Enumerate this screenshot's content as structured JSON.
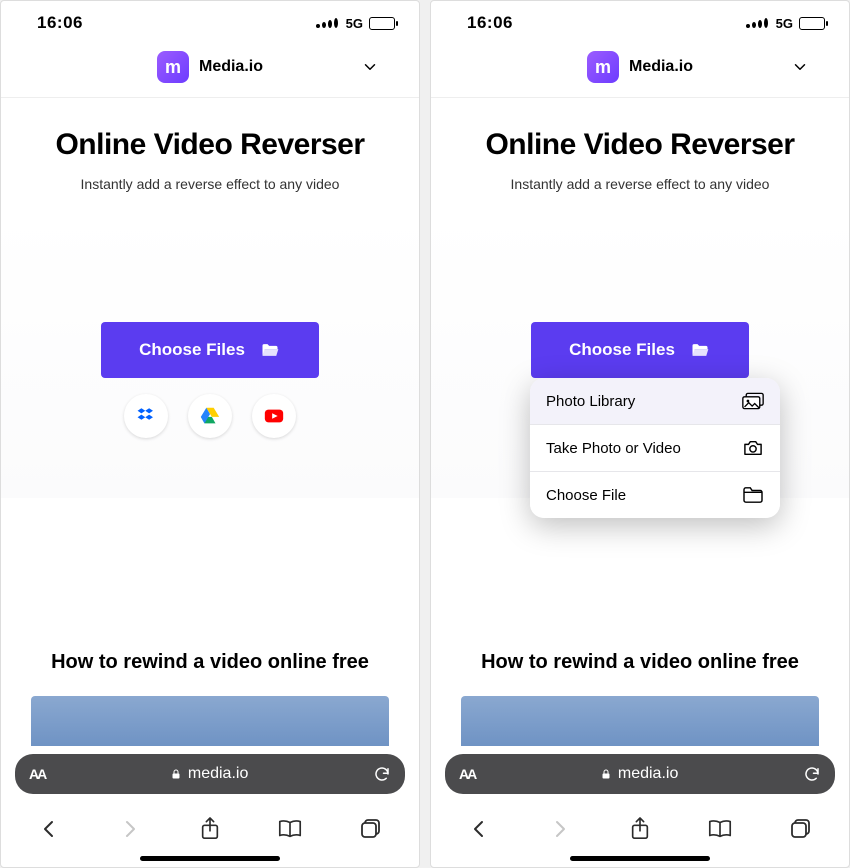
{
  "status": {
    "time": "16:06",
    "network": "5G"
  },
  "header": {
    "brand": "Media.io",
    "logo_glyph": "m"
  },
  "hero": {
    "title": "Online Video Reverser",
    "subtitle": "Instantly add a reverse effect to any video"
  },
  "upload": {
    "button_label": "Choose Files",
    "sources": [
      "dropbox",
      "google-drive",
      "youtube"
    ]
  },
  "picker_menu": {
    "items": [
      {
        "label": "Photo Library",
        "icon": "photos-icon"
      },
      {
        "label": "Take Photo or Video",
        "icon": "camera-icon"
      },
      {
        "label": "Choose File",
        "icon": "folder-icon"
      }
    ]
  },
  "howto": {
    "title": "How to rewind a video online free"
  },
  "browser": {
    "url_text": "media.io",
    "reader_label": "AA"
  }
}
